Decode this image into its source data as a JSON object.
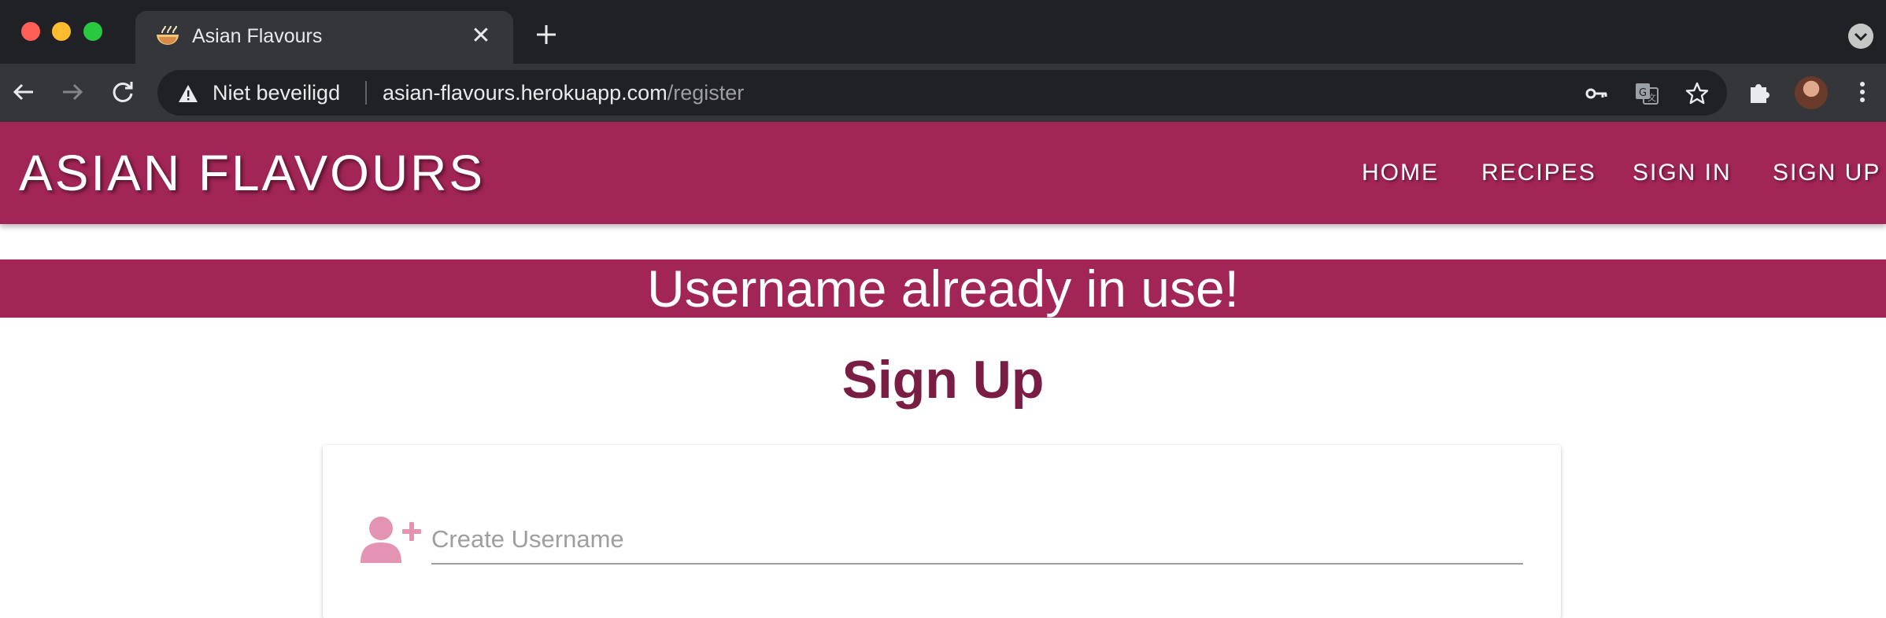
{
  "browser": {
    "tab_title": "Asian Flavours",
    "tab_icon": "ramen-bowl-icon",
    "security_label": "Niet beveiligd",
    "url_host": "asian-flavours.herokuapp.com",
    "url_path": "/register"
  },
  "site": {
    "brand": "ASIAN FLAVOURS",
    "nav": [
      {
        "label": "HOME"
      },
      {
        "label": "RECIPES"
      },
      {
        "label": "SIGN IN"
      },
      {
        "label": "SIGN UP"
      }
    ],
    "brand_color": "#a12555"
  },
  "flash": {
    "message": "Username already in use!"
  },
  "form": {
    "heading": "Sign Up",
    "username": {
      "value": "",
      "placeholder": "Create Username",
      "icon": "user-plus-icon"
    }
  }
}
